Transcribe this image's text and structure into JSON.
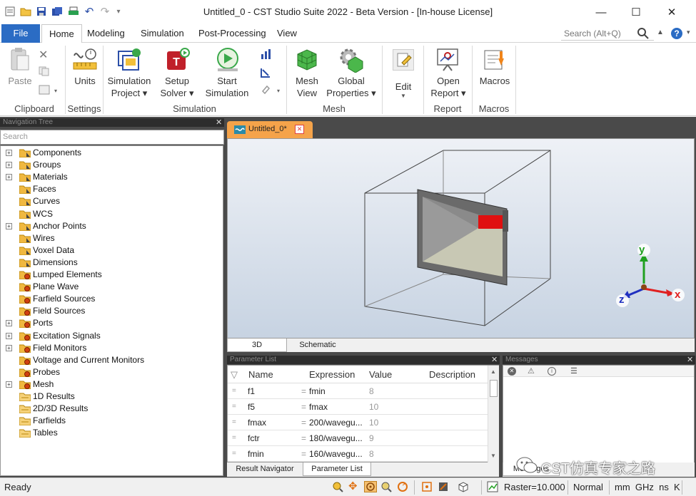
{
  "window": {
    "title": "Untitled_0 - CST Studio Suite 2022 - Beta Version - [In-house License]",
    "minimize_glyph": "—",
    "maximize_glyph": "☐",
    "close_glyph": "✕"
  },
  "menu": {
    "tabs": [
      "File",
      "Home",
      "Modeling",
      "Simulation",
      "Post-Processing",
      "View"
    ],
    "active_tab": "Home",
    "search_placeholder": "Search (Alt+Q)"
  },
  "ribbon": {
    "paste": "Paste",
    "units": "Units",
    "simulation_project": [
      "Simulation",
      "Project ▾"
    ],
    "setup_solver": [
      "Setup",
      "Solver ▾"
    ],
    "start_simulation": [
      "Start",
      "Simulation"
    ],
    "mesh_view": [
      "Mesh",
      "View"
    ],
    "global_properties": [
      "Global",
      "Properties ▾"
    ],
    "edit": "Edit",
    "open_report": [
      "Open",
      "Report ▾"
    ],
    "macros": "Macros",
    "groups": [
      "Clipboard",
      "Settings",
      "Simulation",
      "Mesh",
      "Report",
      "Macros"
    ]
  },
  "nav_tree": {
    "title": "Navigation Tree",
    "search_placeholder": "Search",
    "items": [
      {
        "label": "Components",
        "expandable": true
      },
      {
        "label": "Groups",
        "expandable": true
      },
      {
        "label": "Materials",
        "expandable": true
      },
      {
        "label": "Faces",
        "expandable": false
      },
      {
        "label": "Curves",
        "expandable": false
      },
      {
        "label": "WCS",
        "expandable": false
      },
      {
        "label": "Anchor Points",
        "expandable": true
      },
      {
        "label": "Wires",
        "expandable": false
      },
      {
        "label": "Voxel Data",
        "expandable": false
      },
      {
        "label": "Dimensions",
        "expandable": false
      },
      {
        "label": "Lumped Elements",
        "expandable": false
      },
      {
        "label": "Plane Wave",
        "expandable": false
      },
      {
        "label": "Farfield Sources",
        "expandable": false
      },
      {
        "label": "Field Sources",
        "expandable": false
      },
      {
        "label": "Ports",
        "expandable": true
      },
      {
        "label": "Excitation Signals",
        "expandable": true
      },
      {
        "label": "Field Monitors",
        "expandable": true
      },
      {
        "label": "Voltage and Current Monitors",
        "expandable": false
      },
      {
        "label": "Probes",
        "expandable": false
      },
      {
        "label": "Mesh",
        "expandable": true
      },
      {
        "label": "1D Results",
        "expandable": false
      },
      {
        "label": "2D/3D Results",
        "expandable": false
      },
      {
        "label": "Farfields",
        "expandable": false
      },
      {
        "label": "Tables",
        "expandable": false
      }
    ]
  },
  "viewport": {
    "doc_tab": "Untitled_0*",
    "bottom_tabs": [
      "3D",
      "Schematic"
    ],
    "active_bottom_tab": "3D",
    "axis_x": "x",
    "axis_y": "y",
    "axis_z": "z"
  },
  "parameter_list": {
    "title": "Parameter List",
    "columns": [
      "Name",
      "Expression",
      "Value",
      "Description"
    ],
    "rows": [
      {
        "name": "f1",
        "expression": "fmin",
        "value": "8"
      },
      {
        "name": "f5",
        "expression": "fmax",
        "value": "10"
      },
      {
        "name": "fmax",
        "expression": "200/wavegu...",
        "value": "10"
      },
      {
        "name": "fctr",
        "expression": "180/wavegu...",
        "value": "9"
      },
      {
        "name": "fmin",
        "expression": "160/wavegu...",
        "value": "8"
      }
    ],
    "bottom_tabs": [
      "Result Navigator",
      "Parameter List"
    ],
    "active_bottom_tab": "Parameter List"
  },
  "messages": {
    "title": "Messages",
    "bottom_tab": "Messages",
    "watermark": "CST仿真专家之路"
  },
  "statusbar": {
    "ready": "Ready",
    "raster": "Raster=10.000",
    "mode": "Normal",
    "units": "mm  GHz  ns  K"
  },
  "colors": {
    "file_tab": "#2b6cc4",
    "doc_tab": "#f5a34a",
    "port_red": "#e01010",
    "axis_x": "#e02020",
    "axis_y": "#20a020",
    "axis_z": "#2030c0"
  }
}
